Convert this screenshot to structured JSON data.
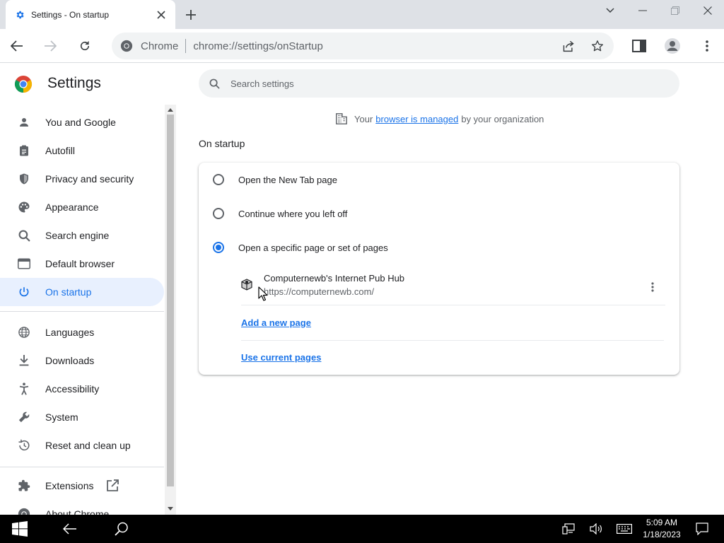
{
  "tab": {
    "title": "Settings - On startup"
  },
  "omnibox": {
    "site_label": "Chrome",
    "url_host": "chrome://",
    "url_path": "settings/onStartup"
  },
  "settings": {
    "title": "Settings",
    "search_placeholder": "Search settings"
  },
  "sidebar": {
    "items": [
      {
        "label": "You and Google",
        "icon": "person-icon"
      },
      {
        "label": "Autofill",
        "icon": "clipboard-icon"
      },
      {
        "label": "Privacy and security",
        "icon": "shield-icon"
      },
      {
        "label": "Appearance",
        "icon": "palette-icon"
      },
      {
        "label": "Search engine",
        "icon": "search-icon"
      },
      {
        "label": "Default browser",
        "icon": "browser-window-icon"
      },
      {
        "label": "On startup",
        "icon": "power-icon",
        "selected": true
      },
      {
        "label": "Languages",
        "icon": "globe-icon"
      },
      {
        "label": "Downloads",
        "icon": "download-icon"
      },
      {
        "label": "Accessibility",
        "icon": "accessibility-icon"
      },
      {
        "label": "System",
        "icon": "wrench-icon"
      },
      {
        "label": "Reset and clean up",
        "icon": "history-icon"
      },
      {
        "label": "Extensions",
        "icon": "puzzle-icon"
      },
      {
        "label": "About Chrome",
        "icon": "chrome-icon"
      }
    ]
  },
  "managed_notice": {
    "prefix": "Your",
    "link": "browser is managed",
    "suffix": "by your organization"
  },
  "on_startup": {
    "section_title": "On startup",
    "options": [
      {
        "label": "Open the New Tab page",
        "checked": false
      },
      {
        "label": "Continue where you left off",
        "checked": false
      },
      {
        "label": "Open a specific page or set of pages",
        "checked": true
      }
    ],
    "pages": [
      {
        "name": "Computernewb's Internet Pub Hub",
        "url": "https://computernewb.com/"
      }
    ],
    "add_page_label": "Add a new page",
    "use_current_label": "Use current pages"
  },
  "taskbar": {
    "time": "5:09 AM",
    "date": "1/18/2023"
  },
  "colors": {
    "accent": "#1a73e8",
    "selected_bg": "#e8f0fe",
    "tabstrip": "#dee1e6"
  }
}
